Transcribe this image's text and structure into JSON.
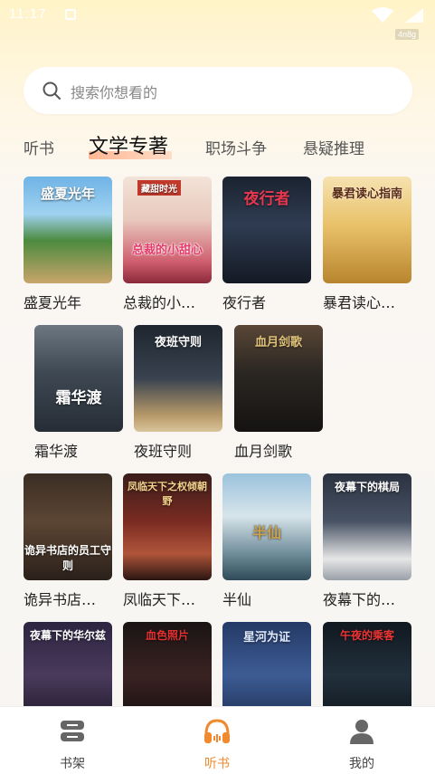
{
  "status_bar": {
    "time": "11:17",
    "net_speed": "4n8g"
  },
  "search": {
    "placeholder": "搜索你想看的"
  },
  "tabs": [
    {
      "label": "听书",
      "active": false
    },
    {
      "label": "文学专著",
      "active": true
    },
    {
      "label": "职场斗争",
      "active": false
    },
    {
      "label": "悬疑推理",
      "active": false
    }
  ],
  "books": [
    {
      "title": "盛夏光年",
      "cover_text": "盛夏光年"
    },
    {
      "title": "总裁的小甜心",
      "display_title": "总裁的小…",
      "cover_text": "总裁的小甜心",
      "cover_top_text": "藏甜时光"
    },
    {
      "title": "夜行者",
      "cover_text": "夜行者"
    },
    {
      "title": "暴君读心指南",
      "display_title": "暴君读心…",
      "cover_text": "暴君读心指南"
    },
    {
      "title": "霜华渡",
      "cover_text": "霜华渡"
    },
    {
      "title": "夜班守则",
      "cover_text": "夜班守则"
    },
    {
      "title": "血月剑歌",
      "cover_text": "血月剑歌"
    },
    {
      "title": "诡异书店员工守则",
      "display_title": "诡异书店…",
      "cover_text": "诡异书店的员工守则"
    },
    {
      "title": "凤临天下",
      "display_title": "凤临天下…",
      "cover_text": "凤临天下之权倾朝野"
    },
    {
      "title": "半仙",
      "cover_text": "半仙"
    },
    {
      "title": "夜幕下的棋局",
      "display_title": "夜幕下的…",
      "cover_text": "夜幕下的棋局"
    },
    {
      "title": "夜幕下的华尔兹",
      "cover_text": "夜幕下的华尔兹"
    },
    {
      "title": "血色照片",
      "cover_text": "血色照片"
    },
    {
      "title": "星河为证",
      "cover_text": "星河为证"
    },
    {
      "title": "午夜的乘客",
      "cover_text": "午夜的乘客"
    }
  ],
  "bottom_nav": [
    {
      "label": "书架",
      "icon": "bookshelf-icon",
      "active": false
    },
    {
      "label": "听书",
      "icon": "headphones-icon",
      "active": true
    },
    {
      "label": "我的",
      "icon": "profile-icon",
      "active": false
    }
  ],
  "colors": {
    "accent": "#f08a2e",
    "tab_underline": "#ffb08a"
  }
}
